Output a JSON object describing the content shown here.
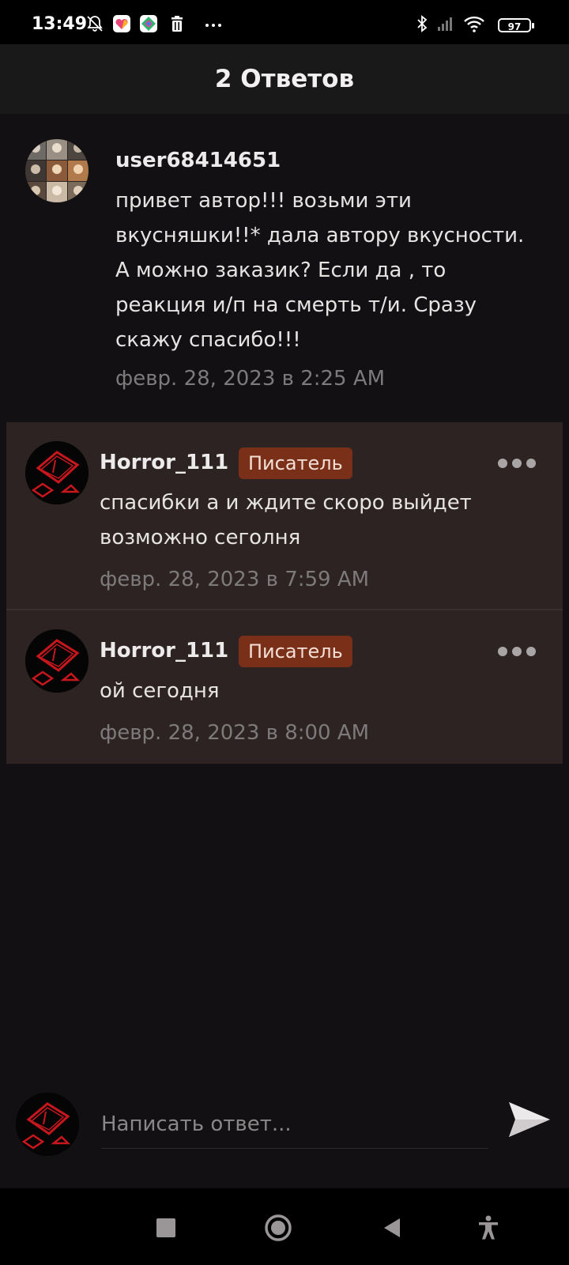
{
  "status_bar": {
    "time": "13:49",
    "battery": "97",
    "icons": [
      "bell-off-icon",
      "app-icon-1",
      "app-icon-2",
      "trash-icon",
      "more-dots-icon",
      "bluetooth-icon",
      "signal-icon",
      "wifi-icon",
      "battery-icon"
    ]
  },
  "header": {
    "title": "2 Ответов"
  },
  "original_comment": {
    "username": "user68414651",
    "text": "привет автор!!! возьми эти вкусняшки!!* дала автору вкусности. А можно заказик? Если да , то реакция и/п на смерть т/и. Сразу скажу спасибо!!!",
    "timestamp": "февр. 28, 2023 в 2:25 AM"
  },
  "replies": [
    {
      "username": "Horror_111",
      "badge": "Писатель",
      "text": "спасибки а и ждите скоро выйдет возможно сеголня",
      "timestamp": "февр. 28, 2023 в 7:59 AM"
    },
    {
      "username": "Horror_111",
      "badge": "Писатель",
      "text": "ой сегодня",
      "timestamp": "февр. 28, 2023 в 8:00 AM"
    }
  ],
  "composer": {
    "placeholder": "Написать ответ..."
  },
  "colors": {
    "background": "#121012",
    "reply_background": "#2e2323",
    "badge_background": "#7a2f18",
    "avatar_accent": "#c8161d"
  }
}
